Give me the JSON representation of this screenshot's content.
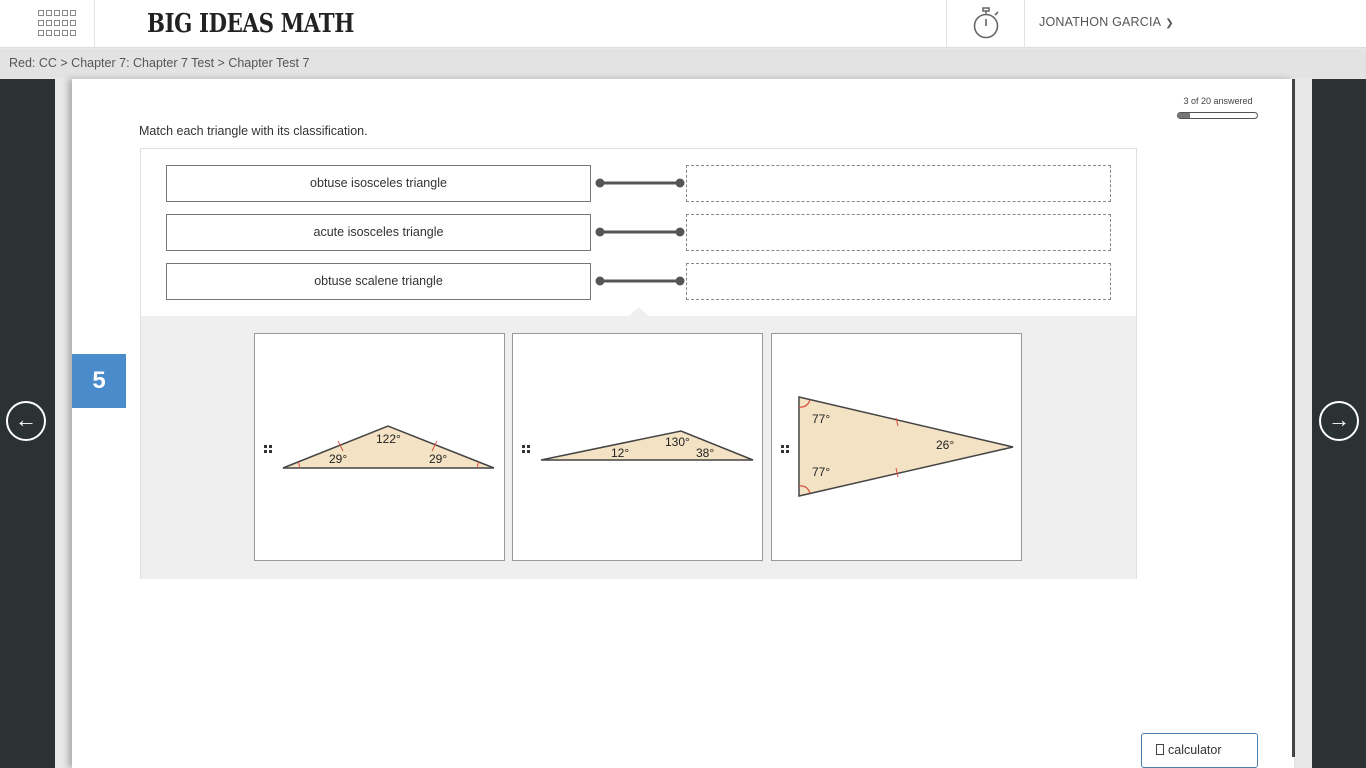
{
  "header": {
    "brand": "BIG IDEAS MATH",
    "user_name": "JONATHON GARCIA",
    "icons": [
      "apps-grid-icon",
      "stopwatch-icon",
      "chevron-down-icon"
    ]
  },
  "breadcrumb": "Red: CC > Chapter 7: Chapter 7 Test > Chapter Test 7",
  "progress": {
    "label": "3 of 20 answered",
    "fraction": 0.15
  },
  "question": {
    "number": "5",
    "prompt": "Match each triangle with its classification."
  },
  "match_rows": [
    {
      "label": "obtuse isosceles triangle"
    },
    {
      "label": "acute isosceles triangle"
    },
    {
      "label": "obtuse scalene triangle"
    }
  ],
  "answer_cards": [
    {
      "angles": [
        "122°",
        "29°",
        "29°"
      ]
    },
    {
      "angles": [
        "130°",
        "12°",
        "38°"
      ]
    },
    {
      "angles": [
        "77°",
        "77°",
        "26°"
      ]
    }
  ],
  "calculator_label": "calculator",
  "colors": {
    "accent_blue": "#4a8ccb",
    "side_panel": "#2b3234",
    "triangle_fill": "#f3e2c4",
    "tick_red": "#d9503f"
  }
}
